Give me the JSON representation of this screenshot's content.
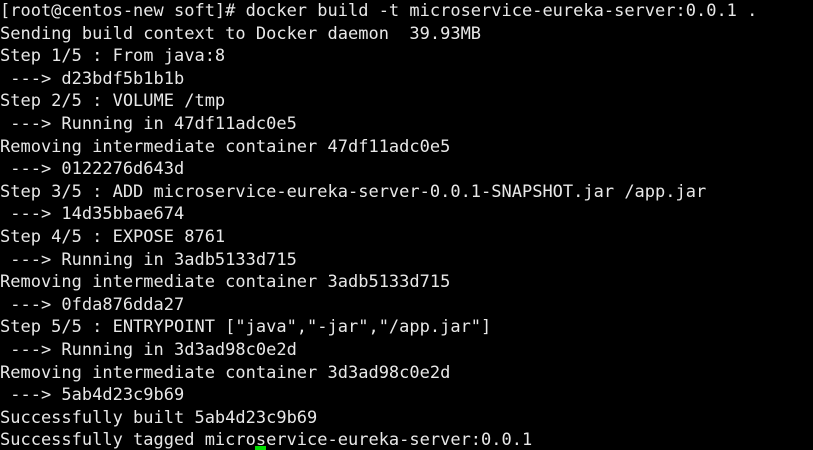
{
  "terminal": {
    "lines": [
      "[root@centos-new soft]# docker build -t microservice-eureka-server:0.0.1 .",
      "Sending build context to Docker daemon  39.93MB",
      "Step 1/5 : From java:8",
      " ---> d23bdf5b1b1b",
      "Step 2/5 : VOLUME /tmp",
      " ---> Running in 47df11adc0e5",
      "Removing intermediate container 47df11adc0e5",
      " ---> 0122276d643d",
      "Step 3/5 : ADD microservice-eureka-server-0.0.1-SNAPSHOT.jar /app.jar",
      " ---> 14d35bbae674",
      "Step 4/5 : EXPOSE 8761",
      " ---> Running in 3adb5133d715",
      "Removing intermediate container 3adb5133d715",
      " ---> 0fda876dda27",
      "Step 5/5 : ENTRYPOINT [\"java\",\"-jar\",\"/app.jar\"]",
      " ---> Running in 3d3ad98c0e2d",
      "Removing intermediate container 3d3ad98c0e2d",
      " ---> 5ab4d23c9b69",
      "Successfully built 5ab4d23c9b69",
      "Successfully tagged microservice-eureka-server:0.0.1"
    ],
    "colors": {
      "background": "#000000",
      "text": "#e8e8e8",
      "cursor": "#00e000"
    }
  }
}
